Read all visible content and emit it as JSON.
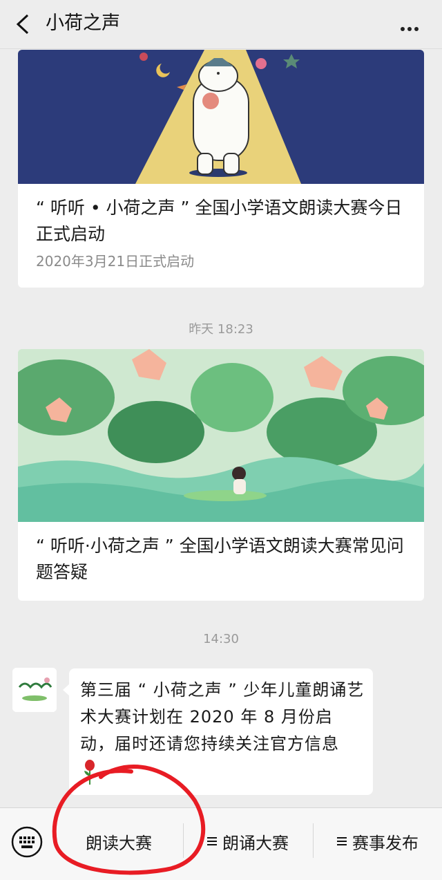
{
  "header": {
    "title": "小荷之声"
  },
  "articles": [
    {
      "title": "“ 听听 • 小荷之声 ” 全国小学语文朗读大赛今日正式启动",
      "subtitle": "2020年3月21日正式启动"
    },
    {
      "title": "“ 听听·小荷之声 ” 全国小学语文朗读大赛常见问题答疑"
    }
  ],
  "timestamps": [
    "昨天 18:23",
    "14:30"
  ],
  "message": {
    "text": "第三届 “ 小荷之声 ” 少年儿童朗诵艺术大赛计划在 2020 年 8 月份启动，届时还请您持续关注官方信息"
  },
  "bottom_menu": [
    {
      "label": "朗读大赛",
      "has_lines_icon": false
    },
    {
      "label": "朗诵大赛",
      "has_lines_icon": true
    },
    {
      "label": "赛事发布",
      "has_lines_icon": true
    }
  ],
  "colors": {
    "background": "#ededed",
    "annotation_circle": "#e81c24"
  }
}
